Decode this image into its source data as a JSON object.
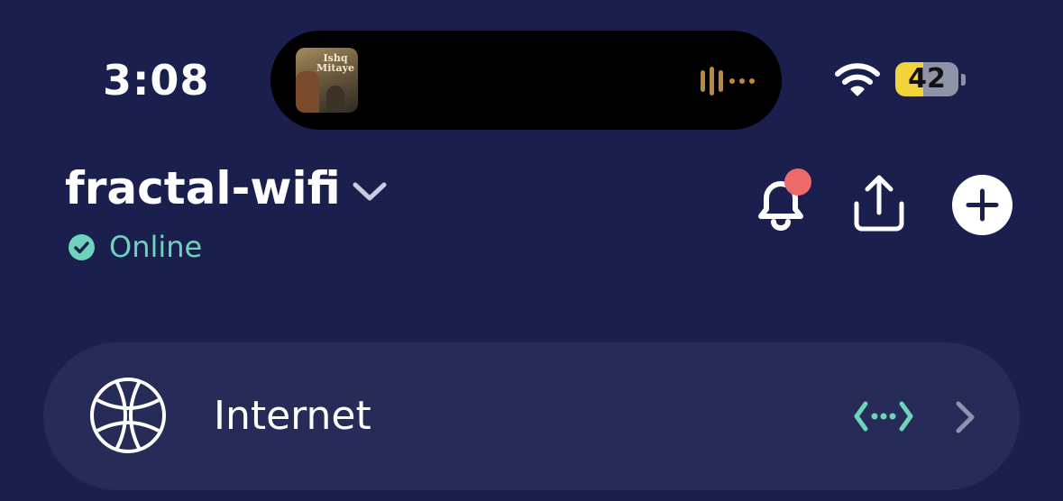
{
  "status_bar": {
    "time": "3:08",
    "now_playing": {
      "album_art_text": "Ishq Mitaye"
    },
    "battery_level": "42"
  },
  "header": {
    "network_name": "fractal-wifi",
    "status": "Online"
  },
  "cards": [
    {
      "label": "Internet",
      "icon": "globe-icon",
      "status_icon": "connection-icon"
    }
  ],
  "colors": {
    "background": "#1a1f4d",
    "card": "#262b58",
    "online": "#6dd3bb",
    "notification": "#ee6a6a",
    "battery": "#f2d33a"
  }
}
